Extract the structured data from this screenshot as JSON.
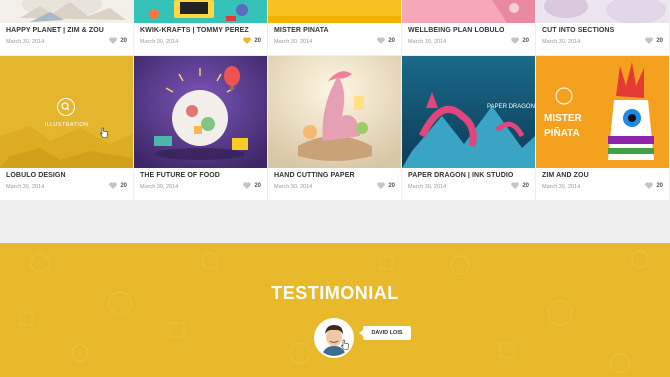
{
  "row1": [
    {
      "title": "HAPPY PLANET | ZIM & ZOU",
      "date": "March 30, 2014",
      "likes": "20"
    },
    {
      "title": "KWIK-KRAFTS | TOMMY PEREZ",
      "date": "March 30, 2014",
      "likes": "20"
    },
    {
      "title": "MISTER PIÑATA",
      "date": "March 30, 2014",
      "likes": "20"
    },
    {
      "title": "WELLBEING PLAN LOBULO",
      "date": "March 30, 2014",
      "likes": "20"
    },
    {
      "title": "CUT INTO SECTIONS",
      "date": "March 30, 2014",
      "likes": "20"
    }
  ],
  "row2": [
    {
      "title": "LOBULO DESIGN",
      "date": "March 30, 2014",
      "likes": "20"
    },
    {
      "title": "THE FUTURE OF FOOD",
      "date": "March 30, 2014",
      "likes": "20"
    },
    {
      "title": "HAND CUTTING PAPER",
      "date": "March 30, 2014",
      "likes": "20"
    },
    {
      "title": "PAPER DRAGON | INK STUDIO",
      "date": "March 30, 2014",
      "likes": "20"
    },
    {
      "title": "ZIM AND ZOU",
      "date": "March 30, 2014",
      "likes": "20"
    }
  ],
  "hover": {
    "label": "ILLUSTRATION",
    "icon": "search-icon"
  },
  "thumb_text": {
    "paper_dragon": "PAPER DRAGON",
    "mister": "MISTER",
    "pinata": "PIÑATA"
  },
  "testimonial": {
    "title": "TESTIMONIAL",
    "author": "DAVID LOIS"
  },
  "colors": {
    "accent": "#e8b92a",
    "like_active": "#e8b92a",
    "like_inactive": "#c4c4c4"
  }
}
